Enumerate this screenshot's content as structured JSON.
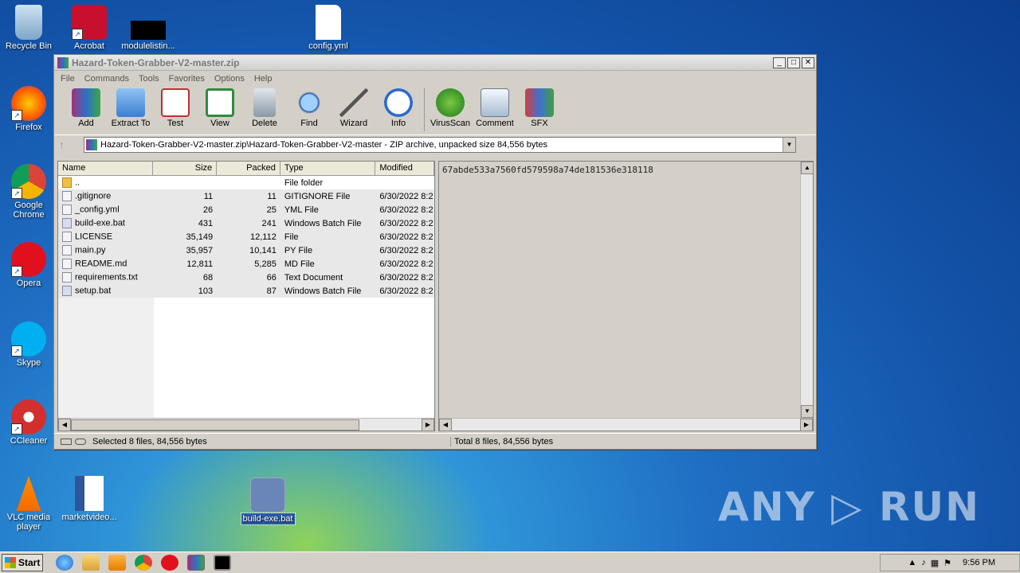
{
  "desktop": {
    "icons": [
      {
        "label": "Recycle Bin"
      },
      {
        "label": "Acrobat"
      },
      {
        "label": "modulelistin..."
      },
      {
        "label": "config.yml"
      },
      {
        "label": "Firefox"
      },
      {
        "label": "Google Chrome"
      },
      {
        "label": "Opera"
      },
      {
        "label": "Skype"
      },
      {
        "label": "CCleaner"
      },
      {
        "label": "VLC media player"
      },
      {
        "label": "marketvideo..."
      },
      {
        "label": "build-exe.bat"
      }
    ],
    "watermark": "ANY ▷ RUN"
  },
  "window": {
    "title": "Hazard-Token-Grabber-V2-master.zip",
    "controls": {
      "minimize": "_",
      "maximize": "□",
      "close": "✕"
    },
    "menu": [
      "File",
      "Commands",
      "Tools",
      "Favorites",
      "Options",
      "Help"
    ],
    "toolbar": [
      "Add",
      "Extract To",
      "Test",
      "View",
      "Delete",
      "Find",
      "Wizard",
      "Info",
      "VirusScan",
      "Comment",
      "SFX"
    ],
    "address": "Hazard-Token-Grabber-V2-master.zip\\Hazard-Token-Grabber-V2-master - ZIP archive, unpacked size 84,556 bytes",
    "columns": {
      "name": "Name",
      "size": "Size",
      "packed": "Packed",
      "type": "Type",
      "modified": "Modified"
    },
    "files": [
      {
        "name": "..",
        "size": "",
        "packed": "",
        "type": "File folder",
        "modified": "",
        "icon": "folder-icon"
      },
      {
        "name": ".gitignore",
        "size": "11",
        "packed": "11",
        "type": "GITIGNORE File",
        "modified": "6/30/2022 8:2",
        "icon": "file-icon"
      },
      {
        "name": "_config.yml",
        "size": "26",
        "packed": "25",
        "type": "YML File",
        "modified": "6/30/2022 8:2",
        "icon": "file-icon"
      },
      {
        "name": "build-exe.bat",
        "size": "431",
        "packed": "241",
        "type": "Windows Batch File",
        "modified": "6/30/2022 8:2",
        "icon": "batch-file-icon"
      },
      {
        "name": "LICENSE",
        "size": "35,149",
        "packed": "12,112",
        "type": "File",
        "modified": "6/30/2022 8:2",
        "icon": "file-icon"
      },
      {
        "name": "main.py",
        "size": "35,957",
        "packed": "10,141",
        "type": "PY File",
        "modified": "6/30/2022 8:2",
        "icon": "file-icon"
      },
      {
        "name": "README.md",
        "size": "12,811",
        "packed": "5,285",
        "type": "MD File",
        "modified": "6/30/2022 8:2",
        "icon": "file-icon"
      },
      {
        "name": "requirements.txt",
        "size": "68",
        "packed": "66",
        "type": "Text Document",
        "modified": "6/30/2022 8:2",
        "icon": "file-icon"
      },
      {
        "name": "setup.bat",
        "size": "103",
        "packed": "87",
        "type": "Windows Batch File",
        "modified": "6/30/2022 8:2",
        "icon": "batch-file-icon"
      }
    ],
    "comment": "67abde533a7560fd579598a74de181536e318118",
    "status_left": "Selected 8 files, 84,556 bytes",
    "status_right": "Total 8 files, 84,556 bytes"
  },
  "taskbar": {
    "start": "Start",
    "time": "9:56 PM"
  }
}
